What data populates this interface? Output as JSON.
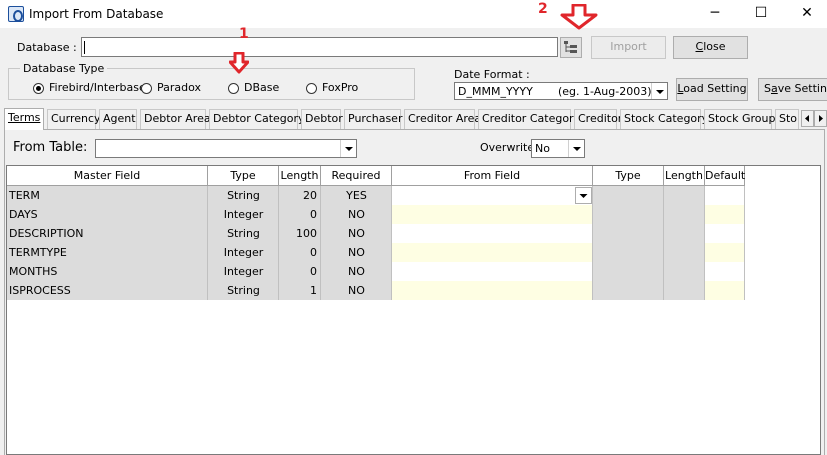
{
  "window": {
    "title": "Import From Database",
    "controls": {
      "minimize": "─",
      "maximize": "☐",
      "close": "✕"
    }
  },
  "database": {
    "label": "Database :",
    "value": "",
    "browse_icon": "folder-tree-icon"
  },
  "buttons": {
    "import": "Import",
    "close": "Close",
    "load_setting": "Load Setting",
    "save_setting": "Save Setting"
  },
  "database_type": {
    "legend": "Database Type",
    "options": [
      {
        "label": "Firebird/Interbase",
        "checked": true
      },
      {
        "label": "Paradox",
        "checked": false
      },
      {
        "label": "DBase",
        "checked": false
      },
      {
        "label": "FoxPro",
        "checked": false
      }
    ]
  },
  "date_format": {
    "label": "Date Format :",
    "value": "D_MMM_YYYY",
    "example": "(eg. 1-Aug-2003)"
  },
  "annotations": {
    "arrow1_number": "1",
    "arrow2_number": "2",
    "color": "#e0262b"
  },
  "tabs": [
    "Terms",
    "Currency",
    "Agent",
    "Debtor Area",
    "Debtor Category",
    "Debtor",
    "Purchaser",
    "Creditor Area",
    "Creditor Category",
    "Creditor",
    "Stock Category",
    "Stock Group",
    "Sto"
  ],
  "active_tab": "Terms",
  "from_table": {
    "label": "From Table:",
    "value": ""
  },
  "overwrite": {
    "label": "Overwrite",
    "value": "No"
  },
  "grid": {
    "columns": [
      "Master Field",
      "Type",
      "Length",
      "Required",
      "From Field",
      "Type",
      "Length",
      "Default"
    ],
    "rows": [
      {
        "master_field": "TERM",
        "type": "String",
        "length": "20",
        "required": "YES",
        "from_field": "",
        "from_type": "",
        "from_length": "",
        "default": ""
      },
      {
        "master_field": "DAYS",
        "type": "Integer",
        "length": "0",
        "required": "NO",
        "from_field": "",
        "from_type": "",
        "from_length": "",
        "default": ""
      },
      {
        "master_field": "DESCRIPTION",
        "type": "String",
        "length": "100",
        "required": "NO",
        "from_field": "",
        "from_type": "",
        "from_length": "",
        "default": ""
      },
      {
        "master_field": "TERMTYPE",
        "type": "Integer",
        "length": "0",
        "required": "NO",
        "from_field": "",
        "from_type": "",
        "from_length": "",
        "default": ""
      },
      {
        "master_field": "MONTHS",
        "type": "Integer",
        "length": "0",
        "required": "NO",
        "from_field": "",
        "from_type": "",
        "from_length": "",
        "default": ""
      },
      {
        "master_field": "ISPROCESS",
        "type": "String",
        "length": "1",
        "required": "NO",
        "from_field": "",
        "from_type": "",
        "from_length": "",
        "default": ""
      }
    ]
  }
}
